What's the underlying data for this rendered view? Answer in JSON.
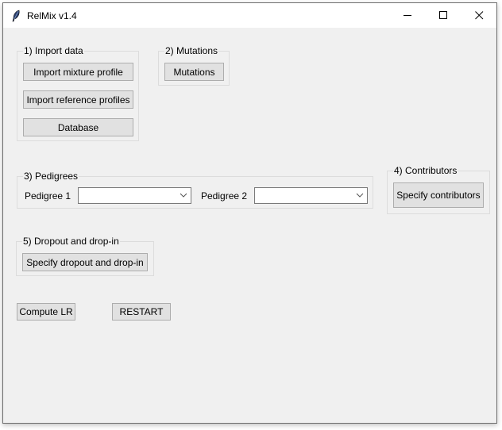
{
  "window": {
    "title": "RelMix v1.4",
    "controls": {
      "minimize": "minimize",
      "maximize": "maximize",
      "close": "close"
    }
  },
  "import_data": {
    "label": "1) Import data",
    "buttons": [
      "Import mixture profile",
      "Import reference profiles",
      "Database"
    ]
  },
  "mutations": {
    "label": "2) Mutations",
    "button": "Mutations"
  },
  "pedigrees": {
    "label": "3) Pedigrees",
    "pedigree1_label": "Pedigree 1",
    "pedigree1_value": "",
    "pedigree2_label": "Pedigree 2",
    "pedigree2_value": ""
  },
  "contributors": {
    "label": "4) Contributors",
    "button": "Specify contributors"
  },
  "dropout": {
    "label": "5) Dropout and drop-in",
    "button": "Specify dropout and drop-in"
  },
  "actions": {
    "compute": "Compute LR",
    "restart": "RESTART"
  }
}
